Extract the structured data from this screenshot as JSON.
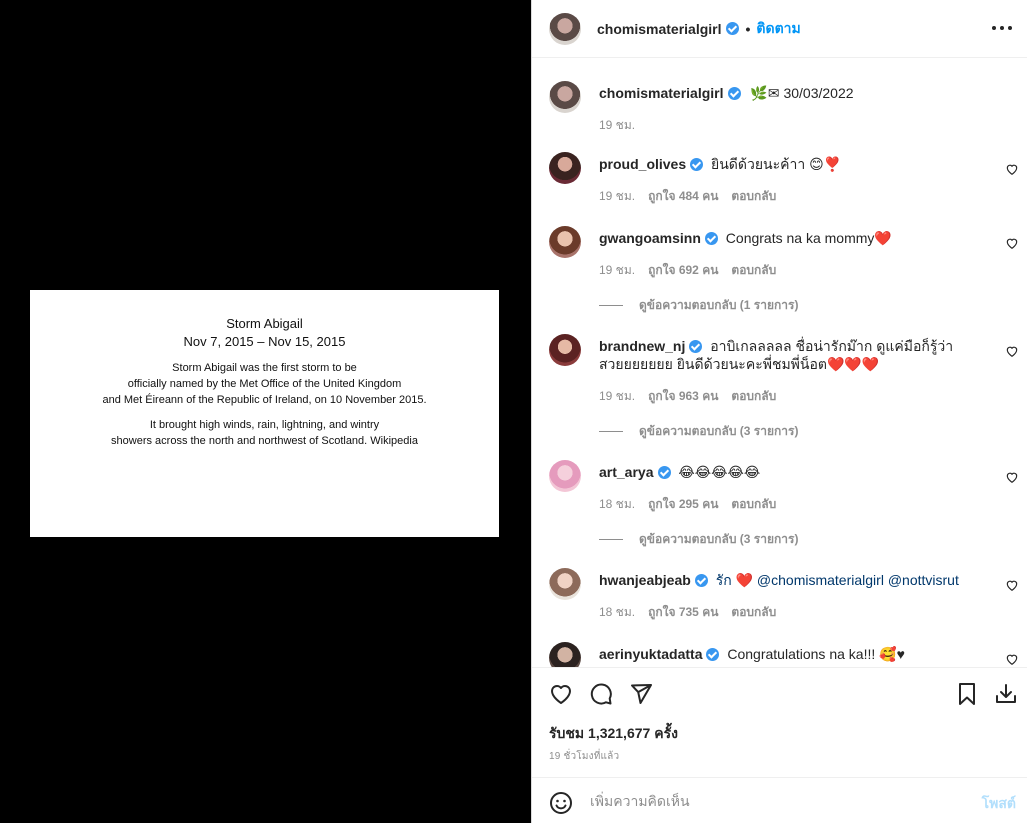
{
  "media": {
    "title": "Storm Abigail",
    "dates": "Nov 7, 2015 – Nov 15, 2015",
    "para1_line1": "Storm Abigail was the first storm to be",
    "para1_line2": "officially named by the Met Office of the United Kingdom",
    "para1_line3": "and Met Éireann of the Republic of Ireland, on 10 November 2015.",
    "para2_line1": "It brought high winds, rain, lightning, and wintry",
    "para2_line2": "showers across the north and northwest of Scotland. Wikipedia"
  },
  "header": {
    "username": "chomismaterialgirl",
    "dot": "•",
    "follow_label": "ติดตาม"
  },
  "caption": {
    "username": "chomismaterialgirl",
    "text": "🌿✉ 30/03/2022",
    "time": "19 ชม."
  },
  "comments": [
    {
      "username": "proud_olives",
      "text": "ยินดีด้วยนะค้าา 😊❣️",
      "time": "19 ชม.",
      "likes": "ถูกใจ 484 คน",
      "reply": "ตอบกลับ"
    },
    {
      "username": "gwangoamsinn",
      "text": "Congrats na ka mommy❤️",
      "time": "19 ชม.",
      "likes": "ถูกใจ 692 คน",
      "reply": "ตอบกลับ",
      "view_replies": "ดูข้อความตอบกลับ (1 รายการ)"
    },
    {
      "username": "brandnew_nj",
      "text": "อาบิเกลลลลล ชื่อน่ารักม๊าก ดูแค่มือก็รู้ว่าสวยยยยยยย ยินดีด้วยนะคะพี่ชมพี่น็อต❤️❤️❤️",
      "time": "19 ชม.",
      "likes": "ถูกใจ 963 คน",
      "reply": "ตอบกลับ",
      "view_replies": "ดูข้อความตอบกลับ (3 รายการ)"
    },
    {
      "username": "art_arya",
      "text": "😂😂😂😂😂",
      "time": "18 ชม.",
      "likes": "ถูกใจ 295 คน",
      "reply": "ตอบกลับ",
      "view_replies": "ดูข้อความตอบกลับ (3 รายการ)"
    },
    {
      "username": "hwanjeabjeab",
      "text": "รัก ❤️ @chomismaterialgirl @nottvisrut",
      "time": "18 ชม.",
      "likes": "ถูกใจ 735 คน",
      "reply": "ตอบกลับ"
    },
    {
      "username": "aerinyuktadatta",
      "text": "Congratulations na ka!!! 🥰♥"
    }
  ],
  "stats": {
    "views": "รับชม 1,321,677 ครั้ง",
    "time": "19 ชั่วโมงที่แล้ว"
  },
  "add_comment": {
    "placeholder": "เพิ่มความคิดเห็น",
    "post_label": "โพสต์"
  },
  "colors": {
    "accent": "#0095f6",
    "verified": "#3897f0",
    "muted": "#8e8e8e",
    "post_disabled": "#b2dffc"
  }
}
